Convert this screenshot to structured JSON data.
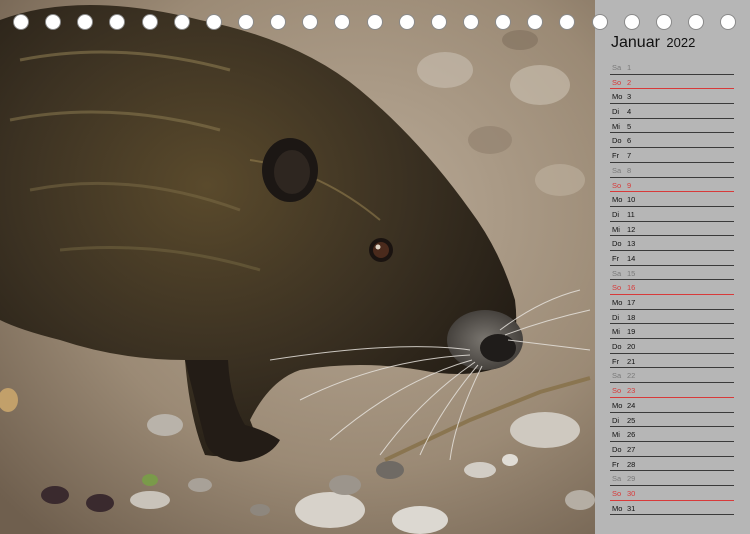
{
  "calendar": {
    "month": "Januar",
    "year": "2022",
    "days": [
      {
        "wd": "Sa",
        "num": "1",
        "kind": "sat"
      },
      {
        "wd": "So",
        "num": "2",
        "kind": "sun"
      },
      {
        "wd": "Mo",
        "num": "3",
        "kind": "weekday"
      },
      {
        "wd": "Di",
        "num": "4",
        "kind": "weekday"
      },
      {
        "wd": "Mi",
        "num": "5",
        "kind": "weekday"
      },
      {
        "wd": "Do",
        "num": "6",
        "kind": "weekday"
      },
      {
        "wd": "Fr",
        "num": "7",
        "kind": "weekday"
      },
      {
        "wd": "Sa",
        "num": "8",
        "kind": "sat"
      },
      {
        "wd": "So",
        "num": "9",
        "kind": "sun"
      },
      {
        "wd": "Mo",
        "num": "10",
        "kind": "weekday"
      },
      {
        "wd": "Di",
        "num": "11",
        "kind": "weekday"
      },
      {
        "wd": "Mi",
        "num": "12",
        "kind": "weekday"
      },
      {
        "wd": "Do",
        "num": "13",
        "kind": "weekday"
      },
      {
        "wd": "Fr",
        "num": "14",
        "kind": "weekday"
      },
      {
        "wd": "Sa",
        "num": "15",
        "kind": "sat"
      },
      {
        "wd": "So",
        "num": "16",
        "kind": "sun"
      },
      {
        "wd": "Mo",
        "num": "17",
        "kind": "weekday"
      },
      {
        "wd": "Di",
        "num": "18",
        "kind": "weekday"
      },
      {
        "wd": "Mi",
        "num": "19",
        "kind": "weekday"
      },
      {
        "wd": "Do",
        "num": "20",
        "kind": "weekday"
      },
      {
        "wd": "Fr",
        "num": "21",
        "kind": "weekday"
      },
      {
        "wd": "Sa",
        "num": "22",
        "kind": "sat"
      },
      {
        "wd": "So",
        "num": "23",
        "kind": "sun"
      },
      {
        "wd": "Mo",
        "num": "24",
        "kind": "weekday"
      },
      {
        "wd": "Di",
        "num": "25",
        "kind": "weekday"
      },
      {
        "wd": "Mi",
        "num": "26",
        "kind": "weekday"
      },
      {
        "wd": "Do",
        "num": "27",
        "kind": "weekday"
      },
      {
        "wd": "Fr",
        "num": "28",
        "kind": "weekday"
      },
      {
        "wd": "Sa",
        "num": "29",
        "kind": "sat"
      },
      {
        "wd": "So",
        "num": "30",
        "kind": "sun"
      },
      {
        "wd": "Mo",
        "num": "31",
        "kind": "weekday"
      }
    ]
  },
  "binding_hole_count": 23,
  "photo": {
    "subject_icon": "nutria-photo"
  },
  "colors": {
    "sidebar_background": "#b6b6b6",
    "weekday_text": "#111111",
    "saturday_text": "#7a7a7a",
    "sunday_text": "#d83a3a",
    "row_line": "#3a3a3a"
  }
}
